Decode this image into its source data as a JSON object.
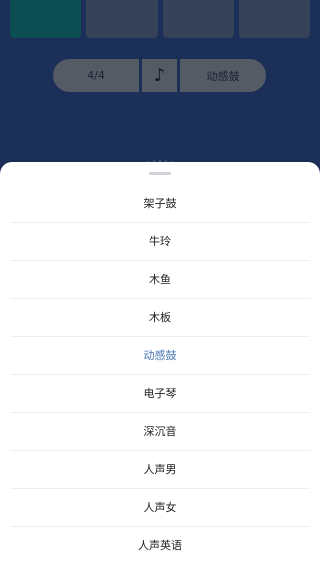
{
  "background": {
    "beats": [
      {
        "active": true
      },
      {
        "active": false
      },
      {
        "active": false
      },
      {
        "active": false
      }
    ],
    "time_signature": "4/4",
    "sound_icon": "♪",
    "current_sound": "动感鼓"
  },
  "sheet": {
    "selected_index": 4,
    "options": [
      {
        "label": "架子鼓"
      },
      {
        "label": "牛玲"
      },
      {
        "label": "木鱼"
      },
      {
        "label": "木板"
      },
      {
        "label": "动感鼓"
      },
      {
        "label": "电子琴"
      },
      {
        "label": "深沉音"
      },
      {
        "label": "人声男"
      },
      {
        "label": "人声女"
      },
      {
        "label": "人声英语"
      }
    ]
  },
  "colors": {
    "selected": "#4a74b4",
    "active_beat": "#167f86",
    "dial_accent": "#4fbf8e"
  }
}
